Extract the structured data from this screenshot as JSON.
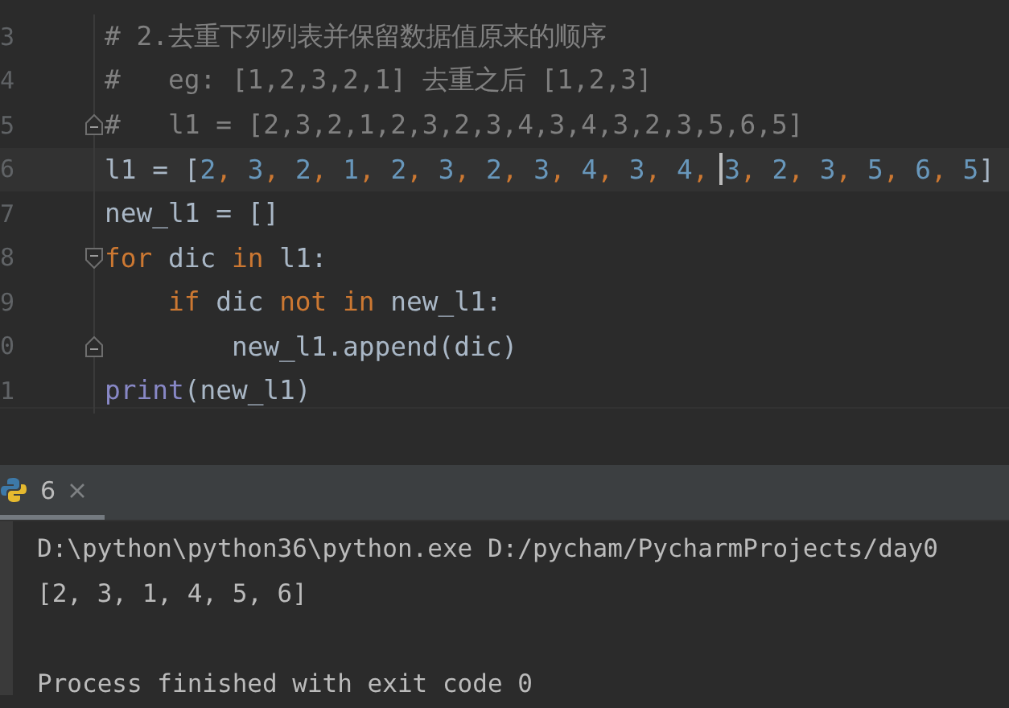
{
  "editor": {
    "lines": [
      {
        "number": "3",
        "tokens": [
          {
            "t": "# 2.去重下列列表并保留数据值原来的顺序",
            "kind": "comment"
          }
        ]
      },
      {
        "number": "4",
        "tokens": [
          {
            "t": "#   eg: [1,2,3,2,1] 去重之后 [1,2,3]",
            "kind": "comment"
          }
        ]
      },
      {
        "number": "5",
        "fold_end": true,
        "tokens": [
          {
            "t": "#   l1 = [2,3,2,1,2,3,2,3,4,3,4,3,2,3,5,6,5]",
            "kind": "comment"
          }
        ]
      },
      {
        "number": "6",
        "current": true,
        "tokens": [
          {
            "t": "l1 = [",
            "kind": "plain"
          },
          {
            "t": "2",
            "kind": "number"
          },
          {
            "t": ", ",
            "kind": "punct"
          },
          {
            "t": "3",
            "kind": "number"
          },
          {
            "t": ", ",
            "kind": "punct"
          },
          {
            "t": "2",
            "kind": "number"
          },
          {
            "t": ", ",
            "kind": "punct"
          },
          {
            "t": "1",
            "kind": "number"
          },
          {
            "t": ", ",
            "kind": "punct"
          },
          {
            "t": "2",
            "kind": "number"
          },
          {
            "t": ", ",
            "kind": "punct"
          },
          {
            "t": "3",
            "kind": "number"
          },
          {
            "t": ", ",
            "kind": "punct"
          },
          {
            "t": "2",
            "kind": "number"
          },
          {
            "t": ", ",
            "kind": "punct"
          },
          {
            "t": "3",
            "kind": "number"
          },
          {
            "t": ", ",
            "kind": "punct"
          },
          {
            "t": "4",
            "kind": "number"
          },
          {
            "t": ", ",
            "kind": "punct"
          },
          {
            "t": "3",
            "kind": "number"
          },
          {
            "t": ", ",
            "kind": "punct"
          },
          {
            "t": "4",
            "kind": "number"
          },
          {
            "t": ", ",
            "kind": "punct"
          },
          {
            "t": "3",
            "kind": "number",
            "caret_before": true
          },
          {
            "t": ", ",
            "kind": "punct"
          },
          {
            "t": "2",
            "kind": "number"
          },
          {
            "t": ", ",
            "kind": "punct"
          },
          {
            "t": "3",
            "kind": "number"
          },
          {
            "t": ", ",
            "kind": "punct"
          },
          {
            "t": "5",
            "kind": "number"
          },
          {
            "t": ", ",
            "kind": "punct"
          },
          {
            "t": "6",
            "kind": "number"
          },
          {
            "t": ", ",
            "kind": "punct"
          },
          {
            "t": "5",
            "kind": "number"
          },
          {
            "t": "]",
            "kind": "plain"
          }
        ]
      },
      {
        "number": "7",
        "tokens": [
          {
            "t": "new_l1 = []",
            "kind": "plain"
          }
        ]
      },
      {
        "number": "8",
        "fold_start": true,
        "tokens": [
          {
            "t": "for ",
            "kind": "keyword"
          },
          {
            "t": "dic ",
            "kind": "plain"
          },
          {
            "t": "in ",
            "kind": "keyword"
          },
          {
            "t": "l1:",
            "kind": "plain"
          }
        ],
        "children": [
          {
            "number": "9",
            "tokens": [
              {
                "t": "if ",
                "kind": "keyword"
              },
              {
                "t": "dic ",
                "kind": "plain"
              },
              {
                "t": "not in ",
                "kind": "keyword"
              },
              {
                "t": "new_l1:",
                "kind": "plain"
              }
            ],
            "children": [
              {
                "number": "0",
                "fold_end": true,
                "tokens": [
                  {
                    "t": "new_l1.append(dic)",
                    "kind": "plain"
                  }
                ]
              }
            ]
          }
        ]
      },
      {
        "number": "1",
        "tokens": [
          {
            "t": "print",
            "kind": "builtin"
          },
          {
            "t": "(new_l1)",
            "kind": "plain"
          }
        ]
      }
    ]
  },
  "run_panel": {
    "tabs": [
      {
        "label": "6",
        "selected": true
      }
    ],
    "output": [
      {
        "text": "D:\\python\\python36\\python.exe D:/pycham/PycharmProjects/day0"
      },
      {
        "text": "[2, 3, 1, 4, 5, 6]"
      },
      {
        "text": "Process finished with exit code 0",
        "blank_before": true
      }
    ]
  }
}
